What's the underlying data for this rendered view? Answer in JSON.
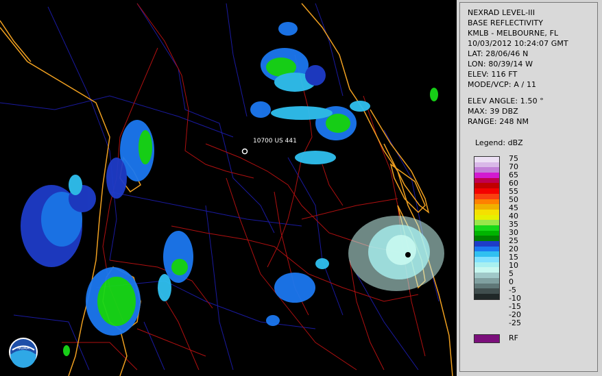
{
  "panel": {
    "lines_top": [
      "NEXRAD LEVEL-III",
      "BASE REFLECTIVITY",
      "KMLB - MELBOURNE, FL",
      "10/03/2012 10:24:07 GMT",
      "LAT: 28/06/46 N",
      "LON: 80/39/14 W",
      "ELEV: 116 FT",
      "MODE/VCP: A / 11"
    ],
    "lines_mid": [
      "ELEV ANGLE: 1.50 °",
      "MAX: 39 DBZ",
      "RANGE: 248 NM"
    ],
    "legend_title": "Legend: dBZ",
    "legend_ticks": [
      "75",
      "70",
      "65",
      "60",
      "55",
      "50",
      "45",
      "40",
      "35",
      "30",
      "25",
      "20",
      "15",
      "10",
      "5",
      "0",
      "-5",
      "-10",
      "-15",
      "-20",
      "-25"
    ],
    "legend_colors": [
      "#ece0f4",
      "#d9b8e8",
      "#c27fd8",
      "#d21ad0",
      "#c00050",
      "#c00000",
      "#f40000",
      "#f84010",
      "#ff8000",
      "#f0b000",
      "#f5e000",
      "#e6f000",
      "#9ae64a",
      "#18d818",
      "#00b400",
      "#008000",
      "#1e3cc8",
      "#1c78f0",
      "#30c0f0",
      "#80e0ff",
      "#a8f0f0",
      "#c8f8f0",
      "#a0c8c8",
      "#80a0a0",
      "#607878",
      "#404e4e",
      "#202828"
    ],
    "rf_label": "RF"
  },
  "map": {
    "site_label": "10700 US 441",
    "logo_text": "NOAA"
  }
}
